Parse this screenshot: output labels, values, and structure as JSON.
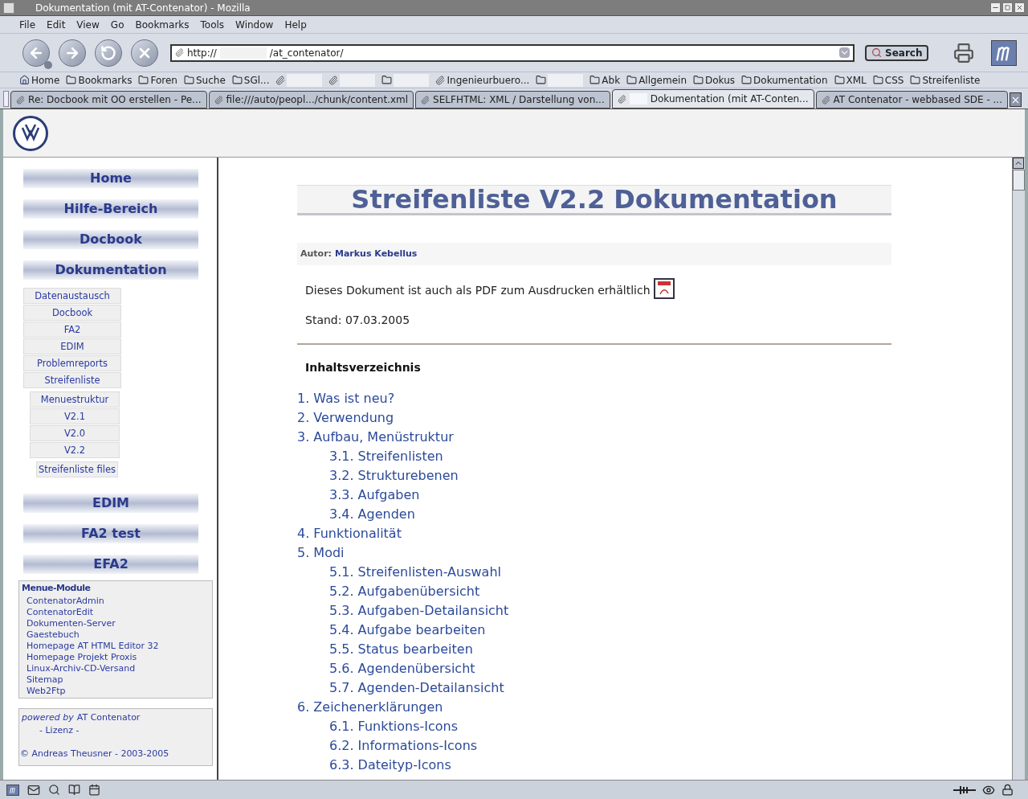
{
  "window": {
    "title": "Dokumentation (mit AT-Contenator) - Mozilla"
  },
  "menu": [
    "File",
    "Edit",
    "View",
    "Go",
    "Bookmarks",
    "Tools",
    "Window",
    "Help"
  ],
  "url": {
    "before": "http://",
    "after": "/at_contenator/"
  },
  "search_button": "Search",
  "bookmarks": [
    {
      "kind": "home",
      "label": "Home"
    },
    {
      "kind": "folder",
      "label": "Bookmarks"
    },
    {
      "kind": "folder",
      "label": "Foren"
    },
    {
      "kind": "folder",
      "label": "Suche"
    },
    {
      "kind": "folder",
      "label": "SGl..."
    },
    {
      "kind": "link"
    },
    {
      "kind": "link"
    },
    {
      "kind": "folder"
    },
    {
      "kind": "link",
      "label": "Ingenieurbuero..."
    },
    {
      "kind": "folder"
    },
    {
      "kind": "folder",
      "label": "Abk"
    },
    {
      "kind": "folder",
      "label": "Allgemein"
    },
    {
      "kind": "folder",
      "label": "Dokus"
    },
    {
      "kind": "folder",
      "label": "Dokumentation"
    },
    {
      "kind": "folder",
      "label": "XML"
    },
    {
      "kind": "folder",
      "label": "CSS"
    },
    {
      "kind": "folder",
      "label": "Streifenliste"
    }
  ],
  "tabs": [
    {
      "label": "Re: Docbook mit OO erstellen - Pe...",
      "selected": false
    },
    {
      "label": "file:///auto/peopl.../chunk/content.xml",
      "selected": false
    },
    {
      "label": "SELFHTML: XML / Darstellung von...",
      "selected": false
    },
    {
      "label": "Dokumentation (mit AT-Conten...",
      "selected": true
    },
    {
      "label": "AT Contenator - webbased SDE - ...",
      "selected": false
    }
  ],
  "sidebar": {
    "nav": [
      {
        "label": "Home"
      },
      {
        "label": "Hilfe-Bereich"
      },
      {
        "label": "Docbook"
      },
      {
        "label": "Dokumentation",
        "children": [
          {
            "label": "Datenaustausch"
          },
          {
            "label": "Docbook"
          },
          {
            "label": "FA2"
          },
          {
            "label": "EDIM"
          },
          {
            "label": "Problemreports"
          },
          {
            "label": "Streifenliste",
            "children": [
              {
                "label": "Menuestruktur"
              },
              {
                "label": "V2.1"
              },
              {
                "label": "V2.0"
              },
              {
                "label": "V2.2",
                "children": [
                  {
                    "label": "Streifenliste files"
                  }
                ]
              }
            ]
          }
        ]
      },
      {
        "label": "EDIM"
      },
      {
        "label": "FA2 test"
      },
      {
        "label": "EFA2"
      }
    ],
    "modules": {
      "title": "Menue-Module",
      "links": [
        "ContenatorAdmin",
        "ContenatorEdit",
        "Dokumenten-Server",
        "Gaestebuch",
        "Homepage AT HTML Editor 32",
        "Homepage Projekt Proxis",
        "Linux-Archiv-CD-Versand",
        "Sitemap",
        "Web2Ftp"
      ]
    },
    "credits": {
      "powered_by": "powered by",
      "product": "AT Contenator",
      "license": "- Lizenz -",
      "copyright": "© Andreas Theusner - 2003-2005"
    }
  },
  "document": {
    "title": "Streifenliste V2.2 Dokumentation",
    "author_label": "Autor:",
    "author": "Markus Kebellus",
    "pdf_note": "Dieses Dokument ist auch als PDF zum Ausdrucken erhältlich",
    "date": "Stand: 07.03.2005",
    "toc_heading": "Inhaltsverzeichnis",
    "toc": [
      {
        "label": "1. Was ist neu?"
      },
      {
        "label": "2. Verwendung"
      },
      {
        "label": "3. Aufbau, Menüstruktur",
        "children": [
          {
            "label": "3.1. Streifenlisten"
          },
          {
            "label": "3.2. Strukturebenen"
          },
          {
            "label": "3.3. Aufgaben"
          },
          {
            "label": "3.4. Agenden"
          }
        ]
      },
      {
        "label": "4. Funktionalität"
      },
      {
        "label": "5. Modi",
        "children": [
          {
            "label": "5.1. Streifenlisten-Auswahl"
          },
          {
            "label": "5.2. Aufgabenübersicht"
          },
          {
            "label": "5.3. Aufgaben-Detailansicht"
          },
          {
            "label": "5.4. Aufgabe bearbeiten"
          },
          {
            "label": "5.5. Status bearbeiten"
          },
          {
            "label": "5.6. Agendenübersicht"
          },
          {
            "label": "5.7. Agenden-Detailansicht"
          }
        ]
      },
      {
        "label": "6. Zeichenerklärungen",
        "children": [
          {
            "label": "6.1. Funktions-Icons"
          },
          {
            "label": "6.2. Informations-Icons"
          },
          {
            "label": "6.3. Dateityp-Icons"
          }
        ]
      }
    ]
  }
}
